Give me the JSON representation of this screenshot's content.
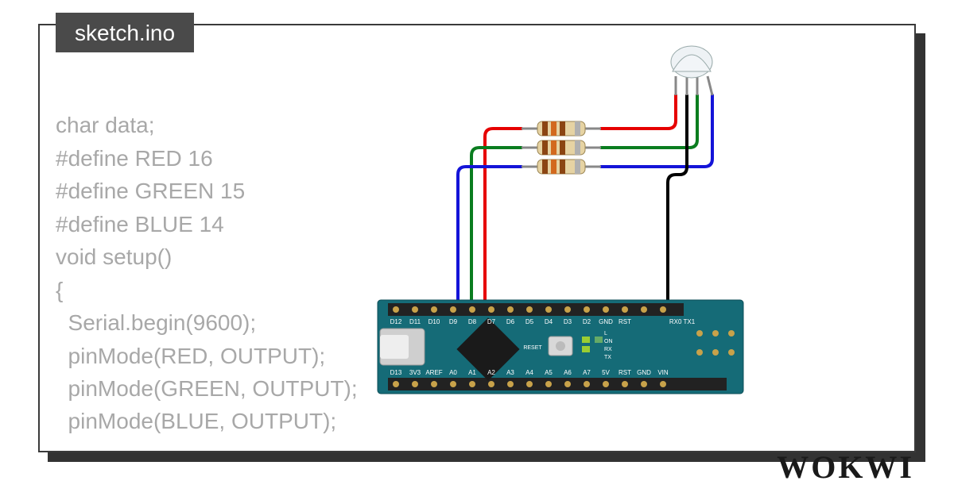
{
  "tab": {
    "filename": "sketch.ino"
  },
  "code": {
    "lines": [
      "char data;",
      "#define RED 16",
      "#define GREEN 15",
      "#define BLUE 14",
      "void setup()",
      "{",
      "  Serial.begin(9600);",
      "  pinMode(RED, OUTPUT);",
      "  pinMode(GREEN, OUTPUT);",
      "  pinMode(BLUE, OUTPUT);"
    ]
  },
  "logo": {
    "text": "WOKWI"
  },
  "wires": {
    "red": {
      "color": "#e60000"
    },
    "green": {
      "color": "#0a7d1f"
    },
    "blue": {
      "color": "#1414d8"
    },
    "black": {
      "color": "#000000"
    }
  },
  "board": {
    "name": "Arduino Nano",
    "body_color": "#1a6b7a",
    "silk_color": "#ffffff",
    "top_labels": [
      "D12",
      "D11",
      "D10",
      "D9",
      "D8",
      "D7",
      "D6",
      "D5",
      "D4",
      "D3",
      "D2",
      "GND",
      "RST"
    ],
    "top_extra": "RX0 TX1",
    "bottom_labels": [
      "D13",
      "3V3",
      "AREF",
      "A0",
      "A1",
      "A2",
      "A3",
      "A4",
      "A5",
      "A6",
      "A7",
      "5V",
      "RST",
      "GND",
      "VIN"
    ],
    "mid_labels": "RESET"
  },
  "resistor": {
    "body": "#e6d3a3",
    "band1": "#8b4513",
    "band2": "#d2691e",
    "band3": "#8b4513",
    "band4": "#a0a0a0"
  },
  "led": {
    "name": "RGB LED"
  }
}
